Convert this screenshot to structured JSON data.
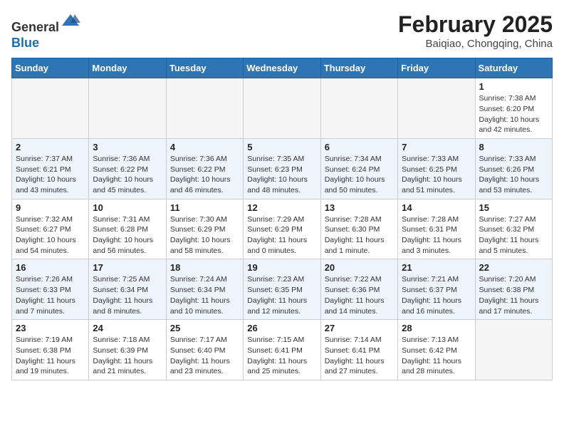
{
  "header": {
    "logo_line1": "General",
    "logo_line2": "Blue",
    "month": "February 2025",
    "location": "Baiqiao, Chongqing, China"
  },
  "weekdays": [
    "Sunday",
    "Monday",
    "Tuesday",
    "Wednesday",
    "Thursday",
    "Friday",
    "Saturday"
  ],
  "weeks": [
    [
      {
        "day": "",
        "info": ""
      },
      {
        "day": "",
        "info": ""
      },
      {
        "day": "",
        "info": ""
      },
      {
        "day": "",
        "info": ""
      },
      {
        "day": "",
        "info": ""
      },
      {
        "day": "",
        "info": ""
      },
      {
        "day": "1",
        "info": "Sunrise: 7:38 AM\nSunset: 6:20 PM\nDaylight: 10 hours\nand 42 minutes."
      }
    ],
    [
      {
        "day": "2",
        "info": "Sunrise: 7:37 AM\nSunset: 6:21 PM\nDaylight: 10 hours\nand 43 minutes."
      },
      {
        "day": "3",
        "info": "Sunrise: 7:36 AM\nSunset: 6:22 PM\nDaylight: 10 hours\nand 45 minutes."
      },
      {
        "day": "4",
        "info": "Sunrise: 7:36 AM\nSunset: 6:22 PM\nDaylight: 10 hours\nand 46 minutes."
      },
      {
        "day": "5",
        "info": "Sunrise: 7:35 AM\nSunset: 6:23 PM\nDaylight: 10 hours\nand 48 minutes."
      },
      {
        "day": "6",
        "info": "Sunrise: 7:34 AM\nSunset: 6:24 PM\nDaylight: 10 hours\nand 50 minutes."
      },
      {
        "day": "7",
        "info": "Sunrise: 7:33 AM\nSunset: 6:25 PM\nDaylight: 10 hours\nand 51 minutes."
      },
      {
        "day": "8",
        "info": "Sunrise: 7:33 AM\nSunset: 6:26 PM\nDaylight: 10 hours\nand 53 minutes."
      }
    ],
    [
      {
        "day": "9",
        "info": "Sunrise: 7:32 AM\nSunset: 6:27 PM\nDaylight: 10 hours\nand 54 minutes."
      },
      {
        "day": "10",
        "info": "Sunrise: 7:31 AM\nSunset: 6:28 PM\nDaylight: 10 hours\nand 56 minutes."
      },
      {
        "day": "11",
        "info": "Sunrise: 7:30 AM\nSunset: 6:29 PM\nDaylight: 10 hours\nand 58 minutes."
      },
      {
        "day": "12",
        "info": "Sunrise: 7:29 AM\nSunset: 6:29 PM\nDaylight: 11 hours\nand 0 minutes."
      },
      {
        "day": "13",
        "info": "Sunrise: 7:28 AM\nSunset: 6:30 PM\nDaylight: 11 hours\nand 1 minute."
      },
      {
        "day": "14",
        "info": "Sunrise: 7:28 AM\nSunset: 6:31 PM\nDaylight: 11 hours\nand 3 minutes."
      },
      {
        "day": "15",
        "info": "Sunrise: 7:27 AM\nSunset: 6:32 PM\nDaylight: 11 hours\nand 5 minutes."
      }
    ],
    [
      {
        "day": "16",
        "info": "Sunrise: 7:26 AM\nSunset: 6:33 PM\nDaylight: 11 hours\nand 7 minutes."
      },
      {
        "day": "17",
        "info": "Sunrise: 7:25 AM\nSunset: 6:34 PM\nDaylight: 11 hours\nand 8 minutes."
      },
      {
        "day": "18",
        "info": "Sunrise: 7:24 AM\nSunset: 6:34 PM\nDaylight: 11 hours\nand 10 minutes."
      },
      {
        "day": "19",
        "info": "Sunrise: 7:23 AM\nSunset: 6:35 PM\nDaylight: 11 hours\nand 12 minutes."
      },
      {
        "day": "20",
        "info": "Sunrise: 7:22 AM\nSunset: 6:36 PM\nDaylight: 11 hours\nand 14 minutes."
      },
      {
        "day": "21",
        "info": "Sunrise: 7:21 AM\nSunset: 6:37 PM\nDaylight: 11 hours\nand 16 minutes."
      },
      {
        "day": "22",
        "info": "Sunrise: 7:20 AM\nSunset: 6:38 PM\nDaylight: 11 hours\nand 17 minutes."
      }
    ],
    [
      {
        "day": "23",
        "info": "Sunrise: 7:19 AM\nSunset: 6:38 PM\nDaylight: 11 hours\nand 19 minutes."
      },
      {
        "day": "24",
        "info": "Sunrise: 7:18 AM\nSunset: 6:39 PM\nDaylight: 11 hours\nand 21 minutes."
      },
      {
        "day": "25",
        "info": "Sunrise: 7:17 AM\nSunset: 6:40 PM\nDaylight: 11 hours\nand 23 minutes."
      },
      {
        "day": "26",
        "info": "Sunrise: 7:15 AM\nSunset: 6:41 PM\nDaylight: 11 hours\nand 25 minutes."
      },
      {
        "day": "27",
        "info": "Sunrise: 7:14 AM\nSunset: 6:41 PM\nDaylight: 11 hours\nand 27 minutes."
      },
      {
        "day": "28",
        "info": "Sunrise: 7:13 AM\nSunset: 6:42 PM\nDaylight: 11 hours\nand 28 minutes."
      },
      {
        "day": "",
        "info": ""
      }
    ]
  ]
}
